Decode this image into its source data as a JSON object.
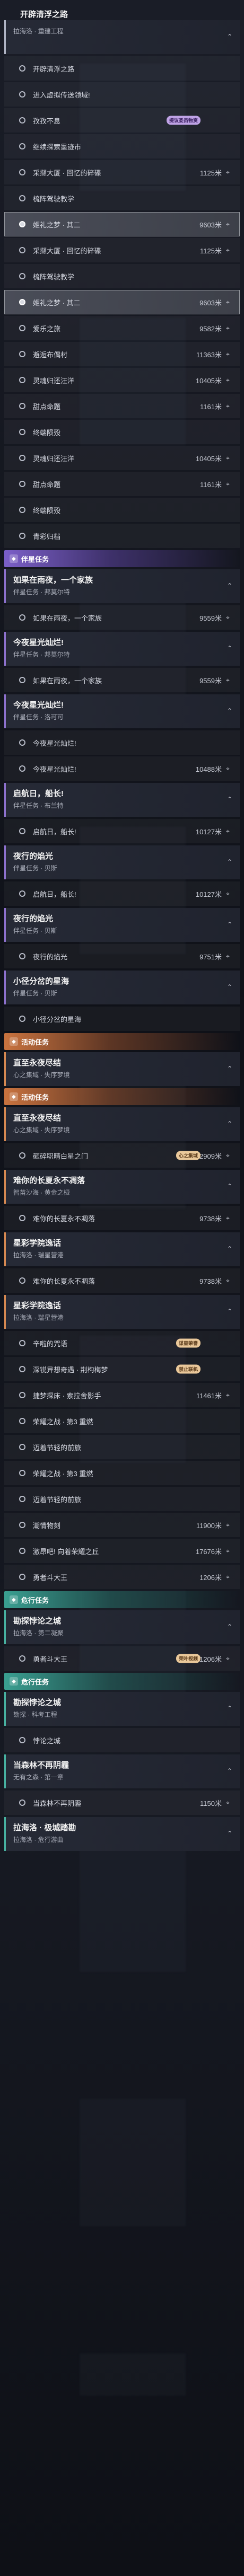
{
  "title": "开辟清浮之路",
  "sections": [
    {
      "type": "quest",
      "cls": "story",
      "title": "",
      "subtitle": "拉海洛 · 重建工程",
      "steps": [
        {
          "label": "开辟清浮之路",
          "dist": "",
          "state": "",
          "mark": ""
        },
        {
          "label": "进入虚拟传送领域!",
          "dist": "",
          "state": "",
          "mark": ""
        },
        {
          "label": "孜孜不息",
          "dist": "",
          "state": "",
          "mark": "提议委员物资"
        },
        {
          "label": "继续探索墨迹市",
          "dist": "",
          "state": "",
          "mark": ""
        },
        {
          "label": "采撷大厦 · 回忆的碎碟",
          "dist": "1125米",
          "state": "",
          "mark": ""
        },
        {
          "label": "梳阵驾驶教学",
          "dist": "",
          "state": "",
          "mark": ""
        },
        {
          "label": "姬礼之梦 · 其二",
          "dist": "9603米",
          "state": "sel",
          "mark": ""
        }
      ]
    },
    {
      "type": "steps",
      "steps": [
        {
          "label": "采撷大厦 · 回忆的碎碟",
          "dist": "1125米",
          "state": "",
          "mark": ""
        },
        {
          "label": "梳阵驾驶教学",
          "dist": "",
          "state": "",
          "mark": ""
        },
        {
          "label": "姬礼之梦 · 其二",
          "dist": "9603米",
          "state": "sel",
          "mark": ""
        },
        {
          "label": "爱乐之旅",
          "dist": "9582米",
          "state": "",
          "mark": ""
        },
        {
          "label": "邂逅布偶村",
          "dist": "11363米",
          "state": "",
          "mark": ""
        },
        {
          "label": "灵魂归还汪洋",
          "dist": "10405米",
          "state": "",
          "mark": ""
        },
        {
          "label": "甜点命题",
          "dist": "1161米",
          "state": "",
          "mark": ""
        },
        {
          "label": "终端陨殁",
          "dist": "",
          "state": "",
          "mark": ""
        },
        {
          "label": "灵魂归还汪洋",
          "dist": "10405米",
          "state": "",
          "mark": ""
        },
        {
          "label": "甜点命题",
          "dist": "1161米",
          "state": "",
          "mark": ""
        },
        {
          "label": "终端陨殁",
          "dist": "",
          "state": "",
          "mark": ""
        },
        {
          "label": "青彩归档",
          "dist": "",
          "state": "",
          "mark": ""
        }
      ]
    },
    {
      "type": "band",
      "cls": "band-purple",
      "label": "伴星任务"
    },
    {
      "type": "quest",
      "cls": "comp",
      "title": "如果在雨夜，一个家族",
      "subtitle": "伴星任务 · 邦莫尔特",
      "steps": [
        {
          "label": "如果在雨夜，一个家族",
          "dist": "9559米",
          "state": "",
          "mark": ""
        }
      ]
    },
    {
      "type": "quest",
      "cls": "comp",
      "title": "今夜星光灿烂!",
      "subtitle": "伴星任务 · 邦莫尔特",
      "steps": [
        {
          "label": "如果在雨夜，一个家族",
          "dist": "9559米",
          "state": "",
          "mark": ""
        }
      ]
    },
    {
      "type": "quest",
      "cls": "comp",
      "title": "今夜星光灿烂!",
      "subtitle": "伴星任务 · 洛可可",
      "steps": [
        {
          "label": "今夜星光灿烂!",
          "dist": "",
          "state": "",
          "mark": ""
        },
        {
          "label": "今夜星光灿烂!",
          "dist": "10488米",
          "state": "",
          "mark": ""
        }
      ]
    },
    {
      "type": "quest",
      "cls": "comp",
      "title": "启航日，船长!",
      "subtitle": "伴星任务 · 布兰特",
      "steps": [
        {
          "label": "启航日，船长!",
          "dist": "10127米",
          "state": "",
          "mark": ""
        }
      ]
    },
    {
      "type": "quest",
      "cls": "comp",
      "title": "夜行的焰光",
      "subtitle": "伴星任务 · 贝斯",
      "steps": [
        {
          "label": "启航日，船长!",
          "dist": "10127米",
          "state": "",
          "mark": ""
        }
      ]
    },
    {
      "type": "quest",
      "cls": "comp",
      "title": "夜行的焰光",
      "subtitle": "伴星任务 · 贝斯",
      "steps": [
        {
          "label": "夜行的焰光",
          "dist": "9751米",
          "state": "",
          "mark": ""
        }
      ]
    },
    {
      "type": "quest",
      "cls": "comp",
      "title": "小径分岔的星海",
      "subtitle": "伴星任务 · 贝斯",
      "steps": [
        {
          "label": "小径分岔的星海",
          "dist": "",
          "state": "",
          "mark": ""
        }
      ]
    },
    {
      "type": "band",
      "cls": "band-orange",
      "label": "活动任务"
    },
    {
      "type": "quest",
      "cls": "event",
      "title": "直至永夜尽结",
      "subtitle": "心之集域 · 失序梦境",
      "steps": []
    },
    {
      "type": "band",
      "cls": "band-orange",
      "label": "活动任务"
    },
    {
      "type": "quest",
      "cls": "event",
      "title": "直至永夜尽结",
      "subtitle": "心之集域 · 失序梦境",
      "steps": [
        {
          "label": "砸碎职晴白星之门",
          "dist": "2909米",
          "state": "",
          "mark": "心之集域"
        }
      ]
    },
    {
      "type": "quest",
      "cls": "event",
      "title": "难你的长夏永不凋落",
      "subtitle": "智苗沙海 · 黄金之桠",
      "steps": [
        {
          "label": "难你的长夏永不凋落",
          "dist": "9738米",
          "state": "",
          "mark": ""
        }
      ]
    },
    {
      "type": "quest",
      "cls": "event",
      "title": "星彩学院逸话",
      "subtitle": "拉海洛 · 瑞星营港",
      "steps": [
        {
          "label": "难你的长夏永不凋落",
          "dist": "9738米",
          "state": "",
          "mark": ""
        }
      ]
    },
    {
      "type": "quest",
      "cls": "event",
      "title": "星彩学院逸话",
      "subtitle": "拉海洛 · 瑞星营港",
      "steps": [
        {
          "label": "辛啦的咒语",
          "dist": "",
          "state": "",
          "mark": "谋星荣誉"
        },
        {
          "label": "深锐异想奇遇 · 荆构梅梦",
          "dist": "",
          "state": "",
          "mark": "禁止联机"
        },
        {
          "label": "捷梦探床 · 索拉舍影手",
          "dist": "11461米",
          "state": "",
          "mark": ""
        },
        {
          "label": "荣耀之战 · 第3 重燃",
          "dist": "",
          "state": "",
          "mark": ""
        },
        {
          "label": "迈着节轻的前旅",
          "dist": "",
          "state": "",
          "mark": ""
        },
        {
          "label": "荣耀之战 · 第3 重燃",
          "dist": "",
          "state": "",
          "mark": ""
        },
        {
          "label": "迈着节轻的前旅",
          "dist": "",
          "state": "",
          "mark": ""
        },
        {
          "label": "潮情物刻",
          "dist": "11900米",
          "state": "",
          "mark": ""
        },
        {
          "label": "激昂吧! 向着荣耀之丘",
          "dist": "17676米",
          "state": "",
          "mark": ""
        },
        {
          "label": "勇者斗大王",
          "dist": "1206米",
          "state": "",
          "mark": ""
        }
      ]
    },
    {
      "type": "band",
      "cls": "band-teal",
      "label": "危行任务"
    },
    {
      "type": "quest",
      "cls": "adv",
      "title": "勘探悖论之城",
      "subtitle": "拉海洛 · 第二凝聚",
      "steps": [
        {
          "label": "勇者斗大王",
          "dist": "1206米",
          "state": "",
          "mark": "荣叶视频"
        }
      ]
    },
    {
      "type": "band",
      "cls": "band-teal",
      "label": "危行任务"
    },
    {
      "type": "quest",
      "cls": "adv",
      "title": "勘探悖论之城",
      "subtitle": "勘探 · 科考工程",
      "steps": [
        {
          "label": "悖论之城",
          "dist": "",
          "state": "",
          "mark": ""
        }
      ]
    },
    {
      "type": "quest",
      "cls": "adv",
      "title": "当森林不再阴霾",
      "subtitle": "无有之森 · 第一章",
      "steps": [
        {
          "label": "当森林不再阴霾",
          "dist": "1150米",
          "state": "",
          "mark": ""
        }
      ]
    },
    {
      "type": "quest",
      "cls": "adv",
      "title": "拉海洛 · 极城踏勘",
      "subtitle": "拉海洛 · 危行游曲",
      "steps": []
    }
  ]
}
